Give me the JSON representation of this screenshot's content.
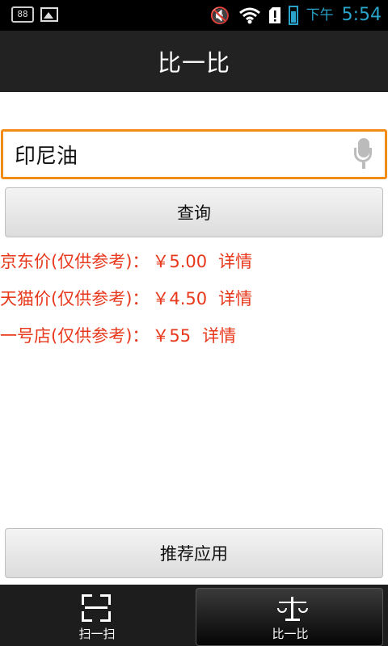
{
  "status_bar": {
    "badge": "88",
    "ampm": "下午",
    "time": "5:54",
    "colors": {
      "clock": "#29a3c9"
    }
  },
  "header": {
    "title": "比一比"
  },
  "search": {
    "value": "印尼油"
  },
  "query_button": {
    "label": "查询"
  },
  "prices": [
    {
      "label": "京东价(仅供参考)：",
      "price": "￥5.00",
      "detail": "详情"
    },
    {
      "label": "天猫价(仅供参考)：",
      "price": "￥4.50",
      "detail": "详情"
    },
    {
      "label": "一号店(仅供参考)：",
      "price": "￥55",
      "detail": "详情"
    }
  ],
  "recommend_button": {
    "label": "推荐应用"
  },
  "bottom_nav": {
    "tabs": [
      {
        "label": "扫一扫",
        "icon": "scan-icon"
      },
      {
        "label": "比一比",
        "icon": "scale-icon",
        "selected": true
      }
    ]
  },
  "colors": {
    "accent_border": "#f28c17",
    "price_text": "#e8381c",
    "title_bar": "#222222"
  }
}
